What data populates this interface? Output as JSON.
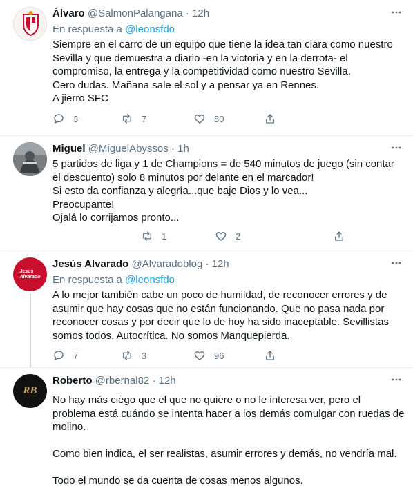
{
  "tweets": [
    {
      "name": "Álvaro",
      "handle": "@SalmonPalangana",
      "sep": " · ",
      "time": "12h",
      "reply_prefix": "En respuesta a ",
      "reply_mention": "@leonsfdo",
      "text": "Siempre en el carro de un equipo que tiene la idea tan clara como nuestro\nSevilla y que demuestra a diario -en la victoria y en la derrota- el\ncompromiso, la entrega y la competitividad como nuestro Sevilla.\nCero dudas. Mañana sale el sol y a pensar ya en Rennes.\nA jierro SFC",
      "replies": "3",
      "retweets": "7",
      "likes": "80"
    },
    {
      "name": "Miguel",
      "handle": "@MiguelAbyssos",
      "sep": " · ",
      "time": "1h",
      "text": "5 partidos de liga y 1 de Champions = de 540 minutos de juego (sin contar\nel descuento) solo 8 minutos por delante en el marcador!\nSi esto da confianza y alegría...que baje Dios y lo vea...\nPreocupante!\nOjalá lo corrijamos pronto...",
      "replies": "",
      "retweets": "1",
      "likes": "2"
    },
    {
      "name": "Jesús Alvarado",
      "handle": "@Alvaradoblog",
      "sep": " · ",
      "time": "12h",
      "reply_prefix": "En respuesta a ",
      "reply_mention": "@leonsfdo",
      "text": "A lo mejor también cabe un poco de humildad, de reconocer errores y de\nasumir que hay cosas que no están funcionando. Que no pasa nada por\nreconocer cosas y por decir que lo de hoy ha sido inaceptable. Sevillistas\nsomos todos. Autocrítica. No somos Manquepierda.",
      "replies": "7",
      "retweets": "3",
      "likes": "96",
      "avatar_text": "Jesús\nAlvarado"
    },
    {
      "name": "Roberto",
      "handle": "@rbernal82",
      "sep": " · ",
      "time": "12h",
      "text": "No hay más ciego que el que no quiere o no le interesa ver, pero el\nproblema está cuándo se intenta hacer a los demás comulgar con ruedas de\nmolino.\n\nComo bien indica, el ser realistas,  asumir errores y demás, no vendría mal.\n\nTodo el mundo se da cuenta de cosas menos algunos.",
      "avatar_text": "RB"
    }
  ],
  "colors": {
    "accent": "#1da1f2",
    "muted": "#5b7083",
    "text": "#0f1419",
    "border": "#e6ecf0"
  },
  "icons": [
    "reply-icon",
    "retweet-icon",
    "like-icon",
    "share-icon",
    "more-icon"
  ]
}
